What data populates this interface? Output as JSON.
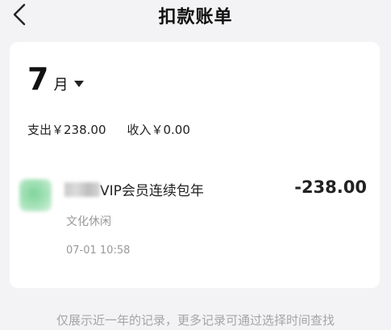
{
  "header": {
    "title": "扣款账单",
    "back_icon": "chevron-left-icon"
  },
  "month_selector": {
    "month": "7",
    "suffix": "月",
    "dropdown_icon": "caret-down-icon"
  },
  "summary": {
    "expense": "支出￥238.00",
    "income": "收入￥0.00"
  },
  "transaction": {
    "title": "VIP会员连续包年",
    "amount": "-238.00",
    "category": "文化休闲",
    "time": "07-01 10:58"
  },
  "footer": {
    "note": "仅展示近一年的记录，更多记录可通过选择时间查找"
  },
  "colors": {
    "page_bg": "#f3f3f5",
    "card_bg": "#ffffff",
    "muted_text": "#999999"
  }
}
